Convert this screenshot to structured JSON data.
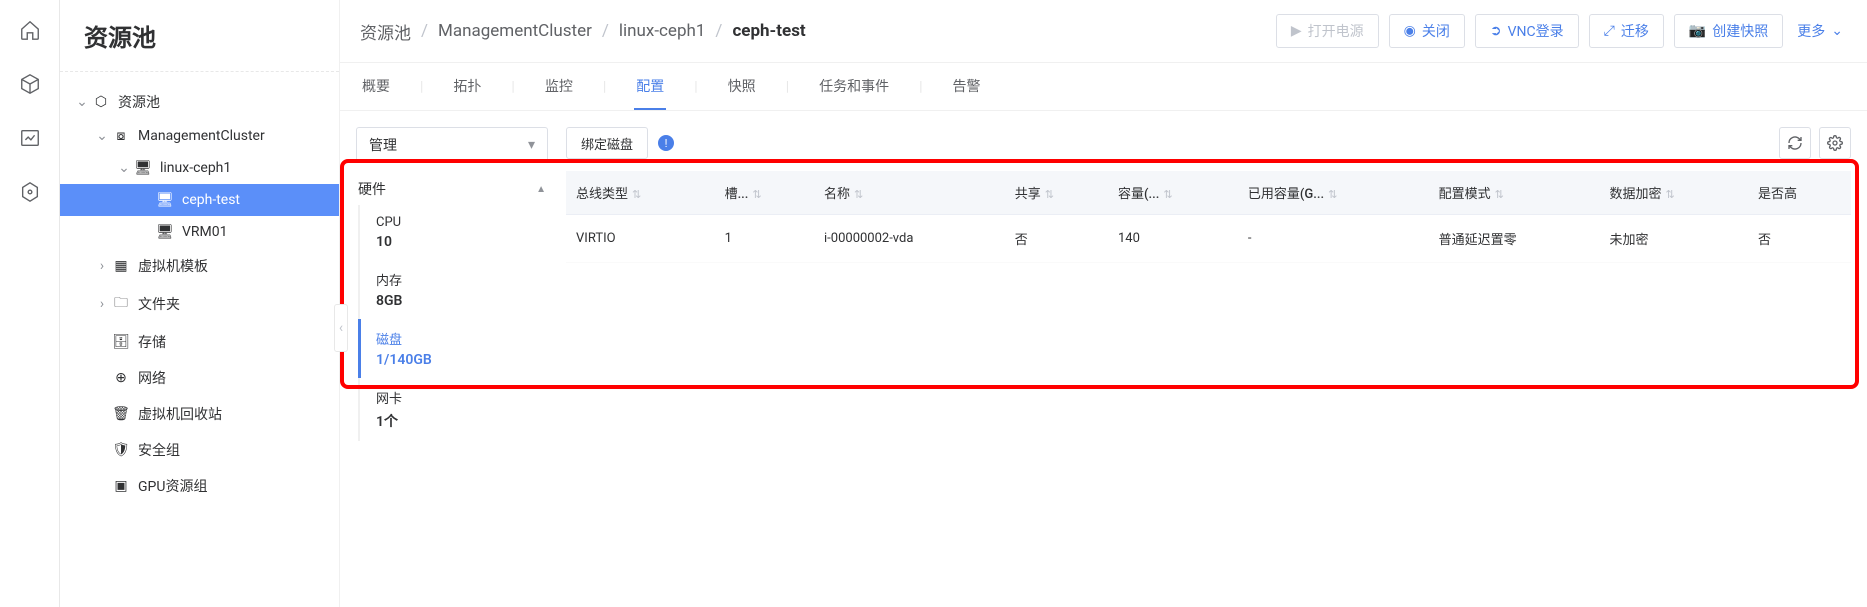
{
  "sidebar": {
    "title": "资源池",
    "tree": {
      "root": "资源池",
      "cluster": "ManagementCluster",
      "host": "linux-ceph1",
      "vm1": "ceph-test",
      "vm2": "VRM01",
      "tpl": "虚拟机模板",
      "folder": "文件夹",
      "storage": "存储",
      "network": "网络",
      "recycle": "虚拟机回收站",
      "secgroup": "安全组",
      "gpu": "GPU资源组"
    }
  },
  "breadcrumb": {
    "a": "资源池",
    "b": "ManagementCluster",
    "c": "linux-ceph1",
    "d": "ceph-test"
  },
  "actions": {
    "power_on": "打开电源",
    "power_off": "关闭",
    "vnc": "VNC登录",
    "migrate": "迁移",
    "snapshot": "创建快照",
    "more": "更多"
  },
  "tabs": {
    "overview": "概要",
    "topology": "拓扑",
    "monitor": "监控",
    "config": "配置",
    "snapshot": "快照",
    "tasks": "任务和事件",
    "alarm": "告警"
  },
  "mgmt": {
    "select": "管理",
    "hw_header": "硬件",
    "items": [
      {
        "lbl": "CPU",
        "val": "10"
      },
      {
        "lbl": "内存",
        "val": "8GB"
      },
      {
        "lbl": "磁盘",
        "val": "1/140GB"
      },
      {
        "lbl": "网卡",
        "val": "1个"
      }
    ]
  },
  "table": {
    "bind_btn": "绑定磁盘",
    "cols": {
      "bus": "总线类型",
      "slot": "槽...",
      "name": "名称",
      "share": "共享",
      "cap": "容量(...",
      "used": "已用容量(G...",
      "mode": "配置模式",
      "encrypt": "数据加密",
      "is": "是否高"
    },
    "rows": [
      {
        "bus": "VIRTIO",
        "slot": "1",
        "name": "i-00000002-vda",
        "share": "否",
        "cap": "140",
        "used": "-",
        "mode": "普通延迟置零",
        "encrypt": "未加密",
        "is": "否"
      }
    ]
  }
}
